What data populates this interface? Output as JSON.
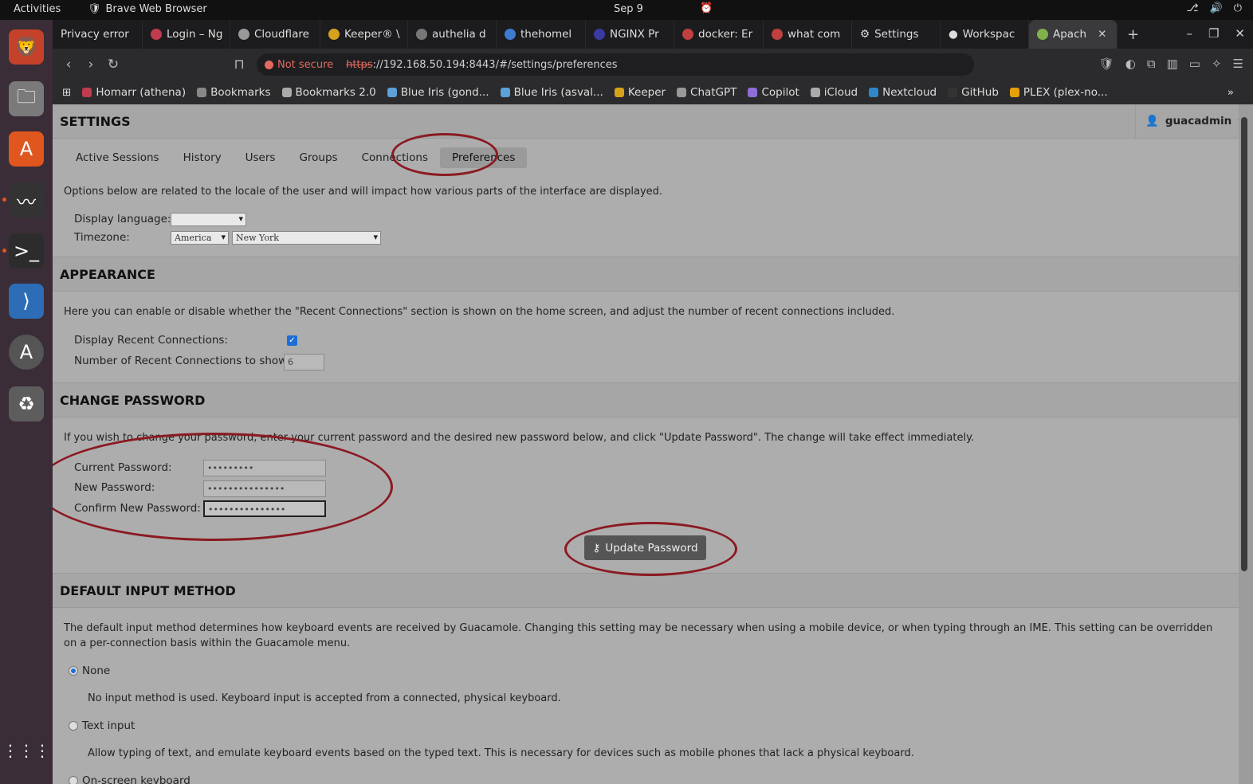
{
  "topbar": {
    "activities": "Activities",
    "app_name": "Brave Web Browser",
    "date": "Sep 9"
  },
  "tabs": [
    {
      "label": "Privacy error"
    },
    {
      "label": "Login – Ng"
    },
    {
      "label": "Cloudflare"
    },
    {
      "label": "Keeper® \\"
    },
    {
      "label": "authelia d"
    },
    {
      "label": "thehomel"
    },
    {
      "label": "NGINX Pr"
    },
    {
      "label": "docker: Er"
    },
    {
      "label": "what com"
    },
    {
      "label": "Settings"
    },
    {
      "label": "Workspac"
    },
    {
      "label": "Apach"
    }
  ],
  "address": {
    "security": "Not secure",
    "scheme": "https",
    "rest": "://192.168.50.194:8443/#/settings/preferences"
  },
  "bookmarks": [
    "Homarr (athena)",
    "Bookmarks",
    "Bookmarks 2.0",
    "Blue Iris (gond...",
    "Blue Iris (asval...",
    "Keeper",
    "ChatGPT",
    "Copilot",
    "iCloud",
    "Nextcloud",
    "GitHub",
    "PLEX (plex-no..."
  ],
  "settings": {
    "title": "SETTINGS",
    "user": "guacadmin",
    "tabs": [
      "Active Sessions",
      "History",
      "Users",
      "Groups",
      "Connections",
      "Preferences"
    ],
    "locale_desc": "Options below are related to the locale of the user and will impact how various parts of the interface are displayed.",
    "display_language_label": "Display language:",
    "display_language_value": "",
    "timezone_label": "Timezone:",
    "timezone_region": "America",
    "timezone_city": "New York"
  },
  "appearance": {
    "title": "APPEARANCE",
    "desc": "Here you can enable or disable whether the \"Recent Connections\" section is shown on the home screen, and adjust the number of recent connections included.",
    "recent_label": "Display Recent Connections:",
    "recent_checked": true,
    "count_label": "Number of Recent Connections to show:",
    "count_value": "6"
  },
  "password": {
    "title": "CHANGE PASSWORD",
    "desc": "If you wish to change your password, enter your current password and the desired new password below, and click \"Update Password\". The change will take effect immediately.",
    "current_label": "Current Password:",
    "current_value": "•••••••••",
    "new_label": "New Password:",
    "new_value": "•••••••••••••••",
    "confirm_label": "Confirm New Password:",
    "confirm_value": "•••••••••••••••",
    "button": "Update Password"
  },
  "input_method": {
    "title": "DEFAULT INPUT METHOD",
    "desc": "The default input method determines how keyboard events are received by Guacamole. Changing this setting may be necessary when using a mobile device, or when typing through an IME. This setting can be overridden on a per-connection basis within the Guacamole menu.",
    "none_label": "None",
    "none_desc": "No input method is used. Keyboard input is accepted from a connected, physical keyboard.",
    "text_label": "Text input",
    "text_desc": "Allow typing of text, and emulate keyboard events based on the typed text. This is necessary for devices such as mobile phones that lack a physical keyboard.",
    "osk_label": "On-screen keyboard"
  }
}
